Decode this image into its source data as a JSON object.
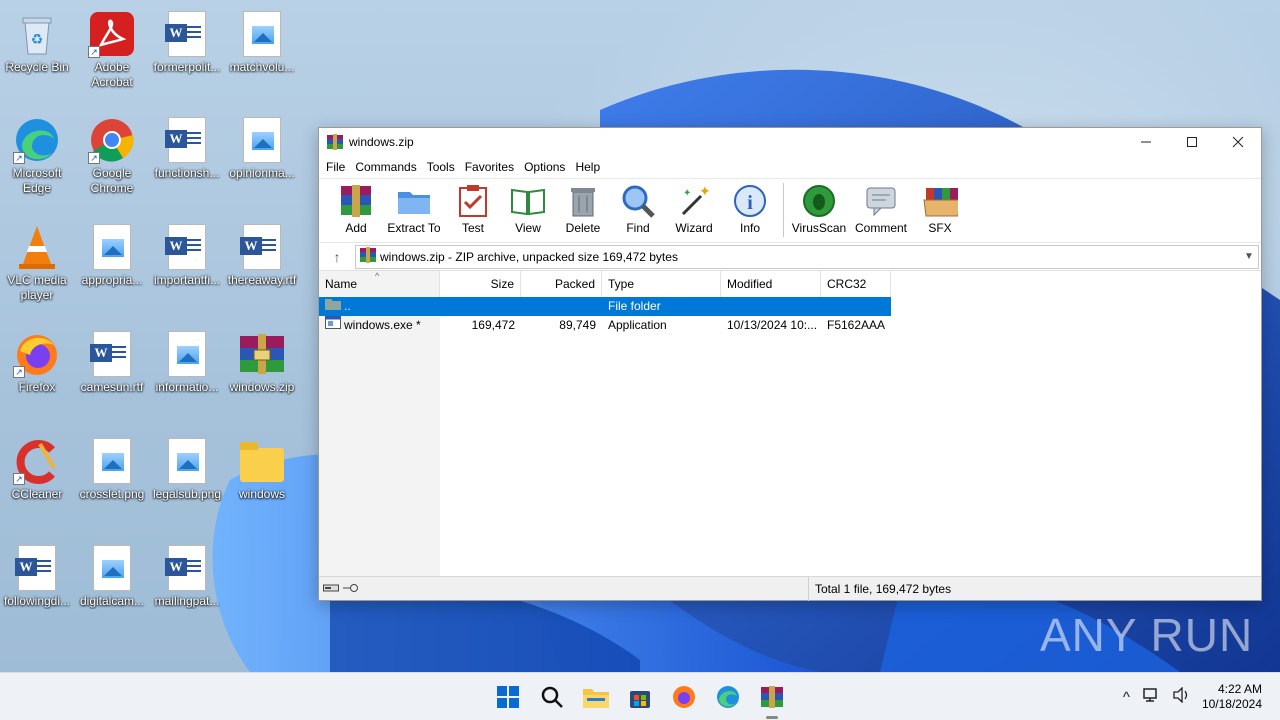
{
  "desktop": {
    "icons": [
      {
        "label": "Recycle Bin"
      },
      {
        "label": "Adobe Acrobat"
      },
      {
        "label": "formerpolit..."
      },
      {
        "label": "matchvolu..."
      },
      {
        "label": "Microsoft Edge"
      },
      {
        "label": "Google Chrome"
      },
      {
        "label": "functionsh..."
      },
      {
        "label": "opinionma..."
      },
      {
        "label": "VLC media player"
      },
      {
        "label": "appropria..."
      },
      {
        "label": "importantfi..."
      },
      {
        "label": "thereaway.rtf"
      },
      {
        "label": "Firefox"
      },
      {
        "label": "camesun.rtf"
      },
      {
        "label": "informatio..."
      },
      {
        "label": "windows.zip"
      },
      {
        "label": "CCleaner"
      },
      {
        "label": "crosslet.png"
      },
      {
        "label": "legalsub.png"
      },
      {
        "label": "windows"
      },
      {
        "label": "followingdi..."
      },
      {
        "label": "digitalcam..."
      },
      {
        "label": "mailingpat..."
      }
    ]
  },
  "window": {
    "title": "windows.zip",
    "menu": [
      "File",
      "Commands",
      "Tools",
      "Favorites",
      "Options",
      "Help"
    ],
    "toolbar": [
      "Add",
      "Extract To",
      "Test",
      "View",
      "Delete",
      "Find",
      "Wizard",
      "Info",
      "VirusScan",
      "Comment",
      "SFX"
    ],
    "address": "windows.zip - ZIP archive, unpacked size 169,472 bytes",
    "columns": [
      "Name",
      "Size",
      "Packed",
      "Type",
      "Modified",
      "CRC32"
    ],
    "rows": [
      {
        "name": "..",
        "size": "",
        "packed": "",
        "type": "File folder",
        "modified": "",
        "crc": ""
      },
      {
        "name": "windows.exe *",
        "size": "169,472",
        "packed": "89,749",
        "type": "Application",
        "modified": "10/13/2024 10:...",
        "crc": "F5162AAA"
      }
    ],
    "status": "Total 1 file, 169,472 bytes"
  },
  "taskbar": {
    "time": "4:22 AM",
    "date": "10/18/2024"
  },
  "watermark": "ANY RUN"
}
